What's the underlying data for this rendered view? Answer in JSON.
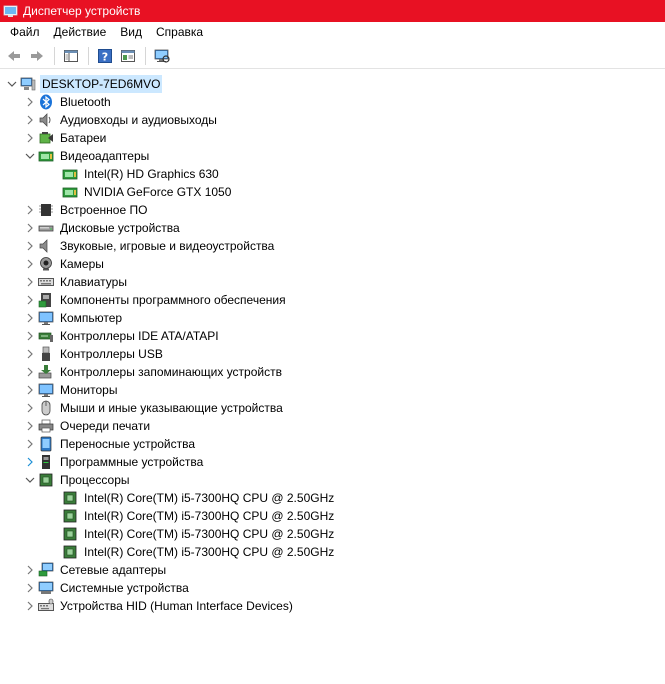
{
  "window": {
    "title": "Диспетчер устройств"
  },
  "menu": {
    "file": "Файл",
    "action": "Действие",
    "view": "Вид",
    "help": "Справка"
  },
  "tree": {
    "root": "DESKTOP-7ED6MVO",
    "bluetooth": "Bluetooth",
    "audio_io": "Аудиовходы и аудиовыходы",
    "batteries": "Батареи",
    "video_adapters": "Видеоадаптеры",
    "gpu_intel": "Intel(R) HD Graphics 630",
    "gpu_nvidia": "NVIDIA GeForce GTX 1050",
    "firmware": "Встроенное ПО",
    "disk_drives": "Дисковые устройства",
    "sound": "Звуковые, игровые и видеоустройства",
    "cameras": "Камеры",
    "keyboards": "Клавиатуры",
    "software_components": "Компоненты программного обеспечения",
    "computer": "Компьютер",
    "ide": "Контроллеры IDE ATA/ATAPI",
    "usb": "Контроллеры USB",
    "storage": "Контроллеры запоминающих устройств",
    "monitors": "Мониторы",
    "mice": "Мыши и иные указывающие устройства",
    "print_queues": "Очереди печати",
    "portable": "Переносные устройства",
    "software_devices": "Программные устройства",
    "processors": "Процессоры",
    "cpu_0": "Intel(R) Core(TM) i5-7300HQ CPU @ 2.50GHz",
    "cpu_1": "Intel(R) Core(TM) i5-7300HQ CPU @ 2.50GHz",
    "cpu_2": "Intel(R) Core(TM) i5-7300HQ CPU @ 2.50GHz",
    "cpu_3": "Intel(R) Core(TM) i5-7300HQ CPU @ 2.50GHz",
    "network": "Сетевые адаптеры",
    "system": "Системные устройства",
    "hid": "Устройства HID (Human Interface Devices)"
  },
  "colors": {
    "titlebar": "#e81123",
    "selection": "#cce8ff"
  }
}
